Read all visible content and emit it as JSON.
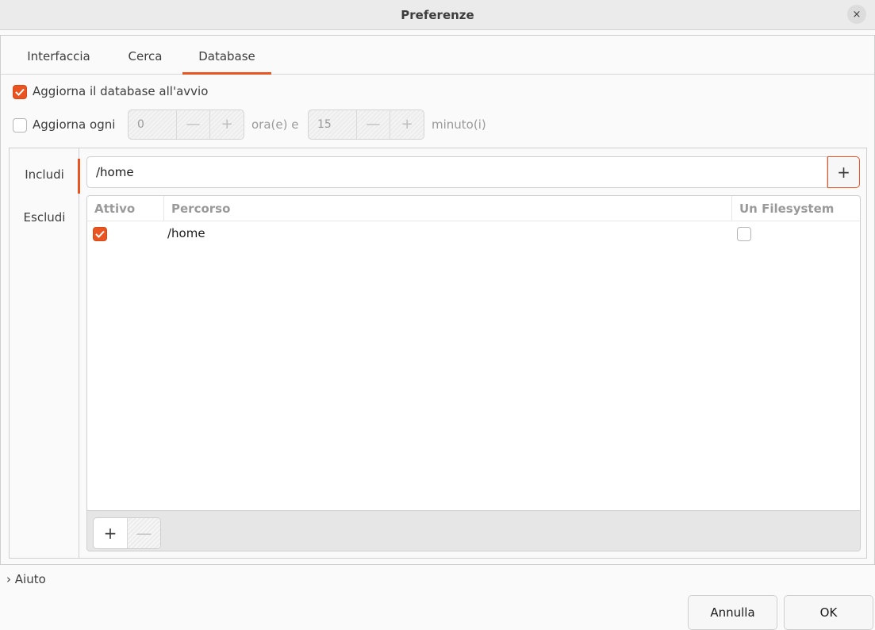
{
  "window": {
    "title": "Preferenze",
    "close_glyph": "×"
  },
  "tabs": [
    {
      "label": "Interfaccia",
      "active": false
    },
    {
      "label": "Cerca",
      "active": false
    },
    {
      "label": "Database",
      "active": true
    }
  ],
  "update_on_startup": {
    "label": "Aggiorna il database all'avvio",
    "checked": true
  },
  "update_every": {
    "label": "Aggiorna ogni",
    "checked": false,
    "hours_value": "0",
    "hours_unit": "ora(e) e",
    "minutes_value": "15",
    "minutes_unit": "minuto(i)",
    "minus_glyph": "—",
    "plus_glyph": "+"
  },
  "sidebar": {
    "items": [
      {
        "label": "Includi",
        "active": true
      },
      {
        "label": "Escludi",
        "active": false
      }
    ]
  },
  "path_entry": {
    "value": "/home",
    "add_glyph": "+"
  },
  "table": {
    "columns": [
      "Attivo",
      "Percorso",
      "Un Filesystem"
    ],
    "rows": [
      {
        "active": true,
        "path": "/home",
        "one_filesystem": false
      }
    ],
    "add_glyph": "+",
    "remove_glyph": "—"
  },
  "help_expander": {
    "label": "Aiuto",
    "glyph": "›"
  },
  "buttons": {
    "cancel": "Annulla",
    "ok": "OK"
  },
  "colors": {
    "accent": "#e95420"
  }
}
